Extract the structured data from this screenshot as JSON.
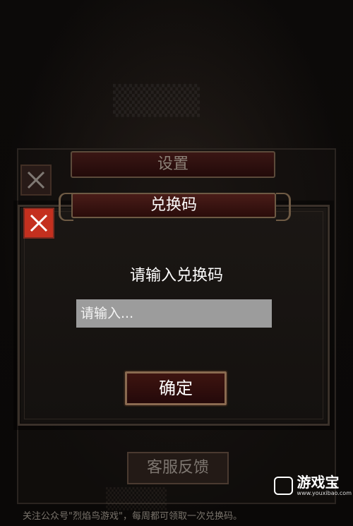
{
  "background": {
    "settings_title": "设置",
    "feedback_button": "客服反馈"
  },
  "dialog": {
    "title": "兑换码",
    "prompt": "请输入兑换码",
    "input_value": "",
    "input_placeholder": "请输入...",
    "confirm_label": "确定"
  },
  "footer": {
    "notice": "关注公众号\"烈焰鸟游戏\"，每周都可领取一次兑换码。"
  },
  "watermark": {
    "brand": "游戏宝",
    "domain": "www.youxibao.com"
  },
  "colors": {
    "close_active": "#c4301f",
    "title_bar": "#3a1614",
    "input_bg": "#9c9c9c"
  }
}
